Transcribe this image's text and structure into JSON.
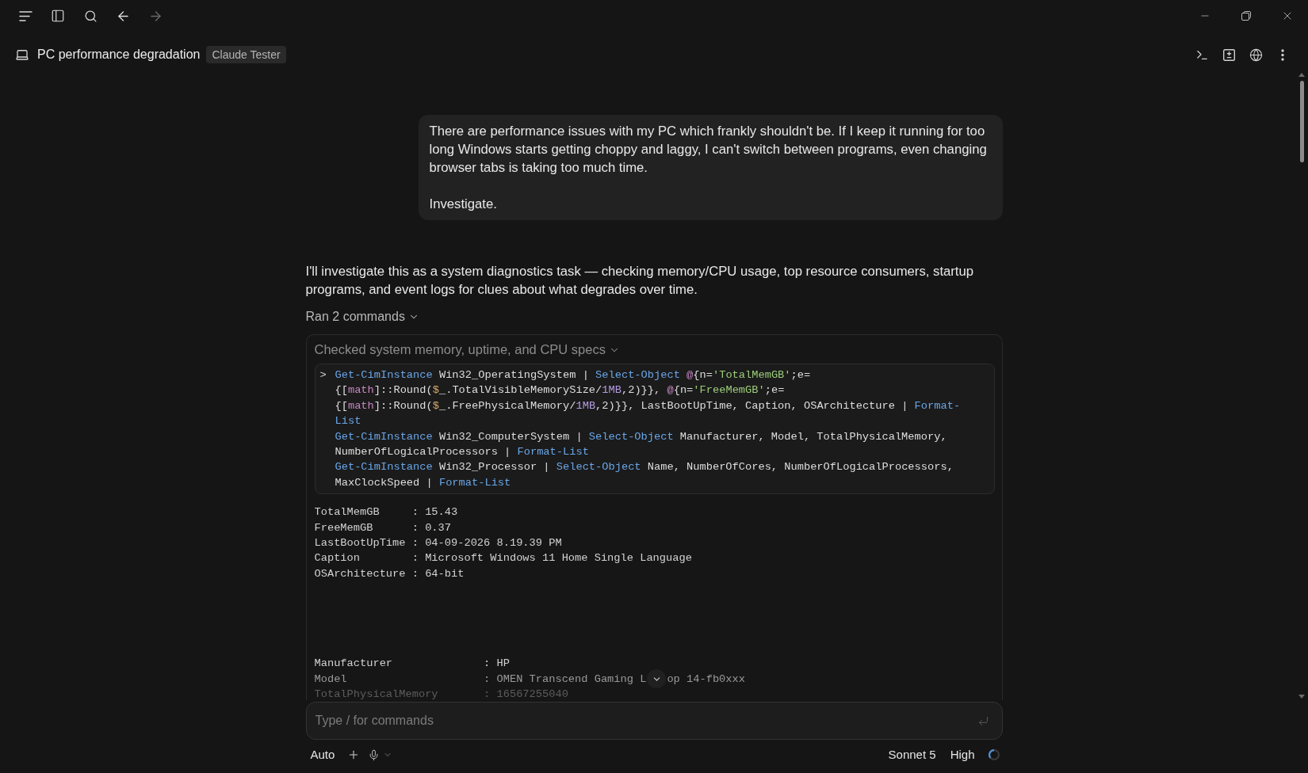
{
  "toolbar": {
    "back": {
      "disabled": false
    },
    "forward": {
      "disabled": true
    }
  },
  "header": {
    "title": "PC performance degradation",
    "badge": "Claude Tester"
  },
  "user_message": {
    "paragraphs": [
      "There are performance issues with my PC which frankly shouldn't be. If I keep it running for too long Windows starts getting choppy and laggy, I can't switch between programs, even changing browser tabs is taking too much time.",
      "Investigate."
    ]
  },
  "assistant_message": {
    "text": "I'll investigate this as a system diagnostics task — checking memory/CPU usage, top resource consumers, startup programs, and event logs for clues about what degrades over time.",
    "commands_toggle": {
      "label": "Ran 2 commands",
      "expanded": true
    },
    "command": {
      "title": "Checked system memory, uptime, and CPU specs",
      "expanded": true,
      "prompt": ">",
      "lines": [
        [
          {
            "kind": "cmd",
            "text": "Get-CimInstance"
          },
          {
            "kind": "plain",
            "text": " Win32_OperatingSystem | "
          },
          {
            "kind": "cmd",
            "text": "Select-Object"
          },
          {
            "kind": "op",
            "text": " @"
          },
          {
            "kind": "plain",
            "text": "{n="
          },
          {
            "kind": "str",
            "text": "'TotalMemGB'"
          },
          {
            "kind": "plain",
            "text": ";e="
          }
        ],
        [
          {
            "kind": "plain",
            "text": "{["
          },
          {
            "kind": "type",
            "text": "math"
          },
          {
            "kind": "plain",
            "text": "]::Round("
          },
          {
            "kind": "var",
            "text": "$"
          },
          {
            "kind": "plain",
            "text": "_.TotalVisibleMemorySize/"
          },
          {
            "kind": "num",
            "text": "1MB"
          },
          {
            "kind": "plain",
            "text": ",2)}}, "
          },
          {
            "kind": "op",
            "text": "@"
          },
          {
            "kind": "plain",
            "text": "{n="
          },
          {
            "kind": "str",
            "text": "'FreeMemGB'"
          },
          {
            "kind": "plain",
            "text": ";e="
          }
        ],
        [
          {
            "kind": "plain",
            "text": "{["
          },
          {
            "kind": "type",
            "text": "math"
          },
          {
            "kind": "plain",
            "text": "]::Round("
          },
          {
            "kind": "var",
            "text": "$"
          },
          {
            "kind": "plain",
            "text": "_.FreePhysicalMemory/"
          },
          {
            "kind": "num",
            "text": "1MB"
          },
          {
            "kind": "plain",
            "text": ",2)}}, LastBootUpTime, Caption, OSArchitecture | "
          },
          {
            "kind": "cmd",
            "text": "Format-"
          }
        ],
        [
          {
            "kind": "cmd",
            "text": "List"
          }
        ],
        [
          {
            "kind": "cmd",
            "text": "Get-CimInstance"
          },
          {
            "kind": "plain",
            "text": " Win32_ComputerSystem | "
          },
          {
            "kind": "cmd",
            "text": "Select-Object"
          },
          {
            "kind": "plain",
            "text": " Manufacturer, Model, TotalPhysicalMemory,"
          }
        ],
        [
          {
            "kind": "plain",
            "text": "NumberOfLogicalProcessors | "
          },
          {
            "kind": "cmd",
            "text": "Format-List"
          }
        ],
        [
          {
            "kind": "cmd",
            "text": "Get-CimInstance"
          },
          {
            "kind": "plain",
            "text": " Win32_Processor | "
          },
          {
            "kind": "cmd",
            "text": "Select-Object"
          },
          {
            "kind": "plain",
            "text": " Name, NumberOfCores, NumberOfLogicalProcessors,"
          }
        ],
        [
          {
            "kind": "plain",
            "text": "MaxClockSpeed | "
          },
          {
            "kind": "cmd",
            "text": "Format-List"
          }
        ]
      ],
      "output": [
        {
          "lines": [
            {
              "kind": "text",
              "text": "TotalMemGB     : 15.43"
            },
            {
              "kind": "text",
              "text": "FreeMemGB      : 0.37"
            },
            {
              "kind": "text",
              "text": "LastBootUpTime : 04-09-2026 8.19.39 PM"
            },
            {
              "kind": "text",
              "text": "Caption        : Microsoft Windows 11 Home Single Language"
            },
            {
              "kind": "text",
              "text": "OSArchitecture : 64-bit"
            }
          ]
        },
        {
          "lines": [
            {
              "kind": "text",
              "text": "Manufacturer              : HP"
            },
            {
              "kind": "split",
              "before": "Model                     : OMEN Transcend Gaming L",
              "after": "op 14-fb0xxx"
            },
            {
              "kind": "text",
              "text": "TotalPhysicalMemory       : 16567255040"
            }
          ]
        }
      ]
    }
  },
  "composer": {
    "placeholder": "Type / for commands",
    "mode": "Auto",
    "model": "Sonnet 5",
    "effort": "High"
  }
}
